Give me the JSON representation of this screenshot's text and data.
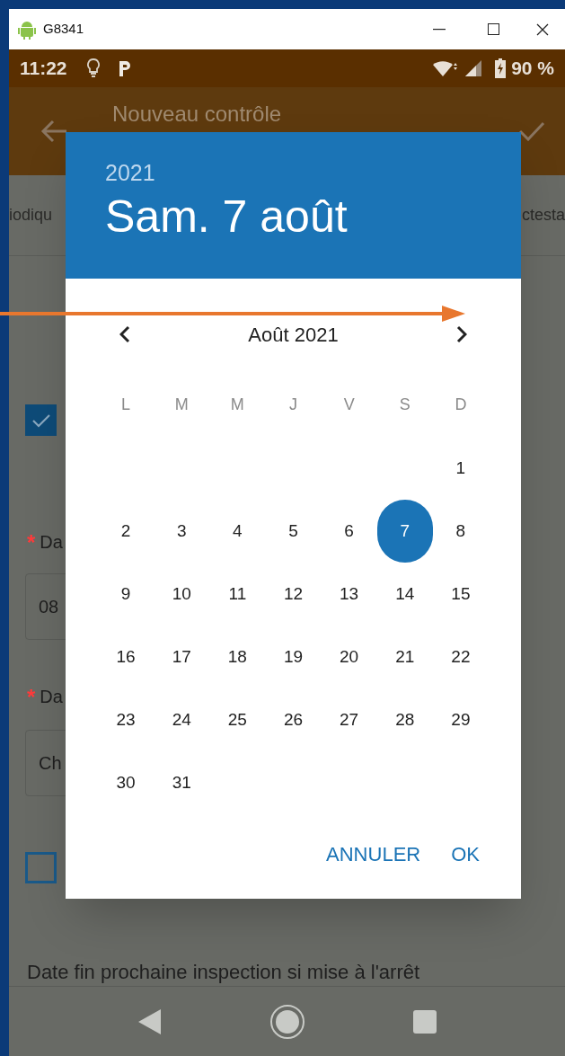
{
  "window": {
    "title": "G8341"
  },
  "status_bar": {
    "time": "11:22",
    "battery": "90 %"
  },
  "app_bar": {
    "title": "Nouveau contrôle"
  },
  "tabs": [
    {
      "label": "iodiqu",
      "selected": false
    },
    {
      "label": "ctesta",
      "selected": false
    }
  ],
  "form": [
    {
      "kind": "checkbox",
      "checked": true
    },
    {
      "kind": "label",
      "marker": "*",
      "text": "Da"
    },
    {
      "kind": "field",
      "value": "08"
    },
    {
      "kind": "label",
      "marker": "*",
      "text": "Da"
    },
    {
      "kind": "field",
      "value": "Ch"
    },
    {
      "kind": "checkbox",
      "checked": false
    },
    {
      "kind": "text",
      "text": "Date fin prochaine inspection si mise à l'arrêt"
    }
  ],
  "date_picker": {
    "year": "2021",
    "date": "Sam. 7 août",
    "month": "Août 2021",
    "weekdays": [
      "L",
      "M",
      "M",
      "J",
      "V",
      "S",
      "D"
    ],
    "weeks": [
      [
        {
          "label": "1",
          "selected": false
        }
      ],
      [
        {
          "label": "2",
          "selected": false
        },
        {
          "label": "3",
          "selected": false
        },
        {
          "label": "4",
          "selected": false
        },
        {
          "label": "5",
          "selected": false
        },
        {
          "label": "6",
          "selected": false
        },
        {
          "label": "7",
          "selected": true
        },
        {
          "label": "8",
          "selected": false
        }
      ],
      [
        {
          "label": "9",
          "selected": false
        },
        {
          "label": "10",
          "selected": false
        },
        {
          "label": "11",
          "selected": false
        },
        {
          "label": "12",
          "selected": false
        },
        {
          "label": "13",
          "selected": false
        },
        {
          "label": "14",
          "selected": false
        },
        {
          "label": "15",
          "selected": false
        }
      ],
      [
        {
          "label": "16",
          "selected": false
        },
        {
          "label": "17",
          "selected": false
        },
        {
          "label": "18",
          "selected": false
        },
        {
          "label": "19",
          "selected": false
        },
        {
          "label": "20",
          "selected": false
        },
        {
          "label": "21",
          "selected": false
        },
        {
          "label": "22",
          "selected": false
        }
      ],
      [
        {
          "label": "23",
          "selected": false
        },
        {
          "label": "24",
          "selected": false
        },
        {
          "label": "25",
          "selected": false
        },
        {
          "label": "26",
          "selected": false
        },
        {
          "label": "27",
          "selected": false
        },
        {
          "label": "28",
          "selected": false
        },
        {
          "label": "29",
          "selected": false
        }
      ],
      [
        {
          "label": "30",
          "selected": false
        },
        {
          "label": "31",
          "selected": false
        }
      ]
    ],
    "buttons": [
      "ANNULER",
      "OK"
    ]
  }
}
